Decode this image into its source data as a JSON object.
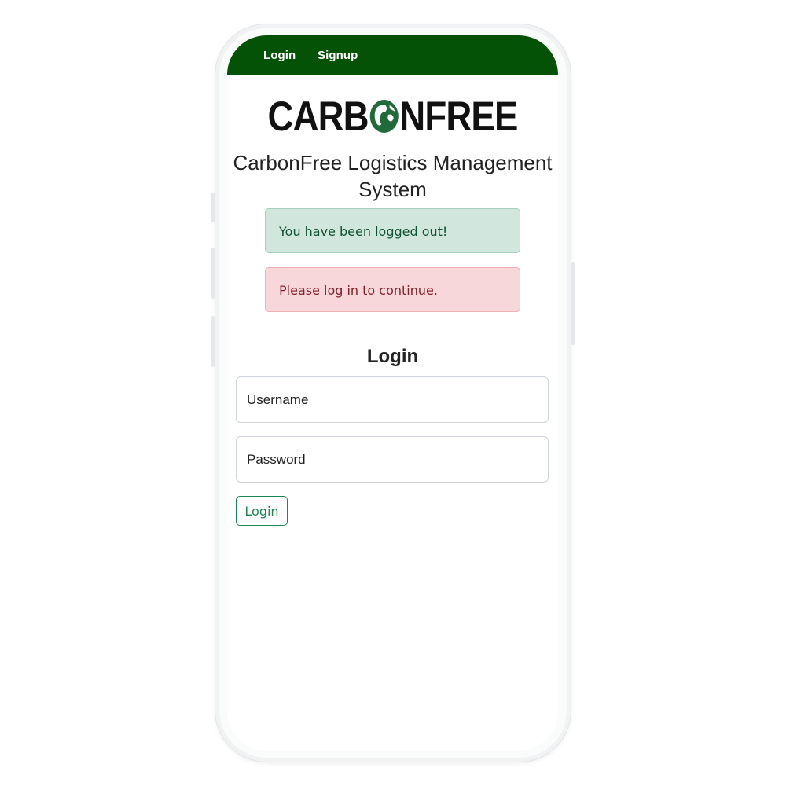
{
  "nav": {
    "login_label": "Login",
    "signup_label": "Signup"
  },
  "brand": {
    "logo_left": "CARB",
    "logo_right": "NFREE",
    "logo_text": "CARBONFREE",
    "globe_icon": "globe-icon"
  },
  "page": {
    "title": "CarbonFree Logistics Management System"
  },
  "alerts": {
    "success": "You have been logged out!",
    "danger": "Please log in to continue."
  },
  "login_form": {
    "heading": "Login",
    "username_placeholder": "Username",
    "password_placeholder": "Password",
    "submit_label": "Login"
  },
  "colors": {
    "navbar": "#045205",
    "success_bg": "#d1e7dd",
    "danger_bg": "#f8d7da",
    "button_green": "#198754"
  }
}
